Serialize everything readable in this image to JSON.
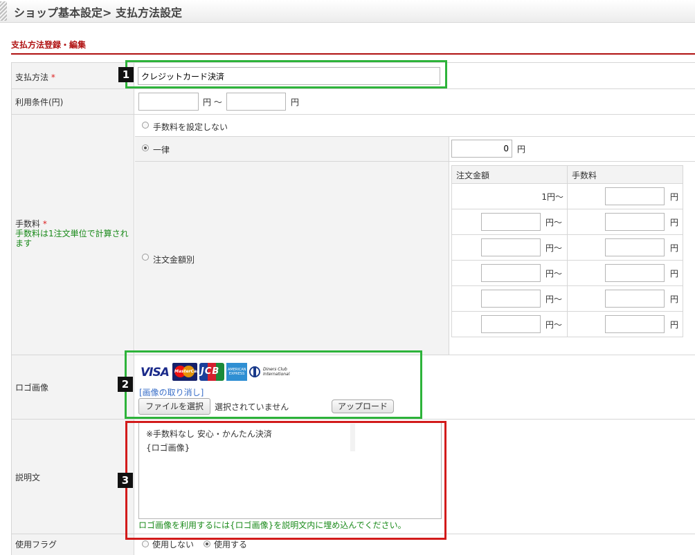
{
  "header": {
    "title": "ショップ基本設定> 支払方法設定"
  },
  "section": {
    "title": "支払方法登録・編集"
  },
  "payment_method": {
    "label": "支払方法",
    "required_mark": "*",
    "value": "クレジットカード決済",
    "badge": "1"
  },
  "conditions": {
    "label": "利用条件(円)",
    "unit1": "円 ～",
    "unit2": "円",
    "min": "",
    "max": ""
  },
  "fee": {
    "label": "手数料",
    "required_mark": "*",
    "note": "手数料は1注文単位で計算されます",
    "option_none": "手数料を設定しない",
    "option_flat": "一律",
    "flat_value": "0",
    "flat_unit": "円",
    "option_by_amount": "注文金額別",
    "selected": "一律",
    "table": {
      "col_amount": "注文金額",
      "col_fee": "手数料",
      "first_amount": "1円～",
      "amount_suffix": "円～",
      "fee_unit": "円",
      "rows": [
        "",
        "",
        "",
        "",
        ""
      ]
    }
  },
  "logo": {
    "label": "ロゴ画像",
    "badge": "2",
    "cards": [
      "VISA",
      "MasterCard",
      "JCB",
      "AMERICAN EXPRESS",
      "Diners Club International"
    ],
    "remove_link": "[画像の取り消し]",
    "file_button": "ファイルを選択",
    "file_status": "選択されていません",
    "upload_button": "アップロード"
  },
  "description": {
    "label": "説明文",
    "badge": "3",
    "value": "※手数料なし 安心・かんたん決済\n{ロゴ画像}",
    "note": "ロゴ画像を利用するには{ロゴ画像}を説明文内に埋め込んでください。"
  },
  "usage_flag": {
    "label": "使用フラグ",
    "option_off": "使用しない",
    "option_on": "使用する"
  },
  "colors": {
    "accent": "#b01111",
    "callout_green": "#2db33a",
    "callout_red": "#d21b1b",
    "note_green": "#1a8a1a"
  },
  "icons": [
    "header-stripe-icon",
    "radio-icon",
    "card-logo-icons"
  ]
}
